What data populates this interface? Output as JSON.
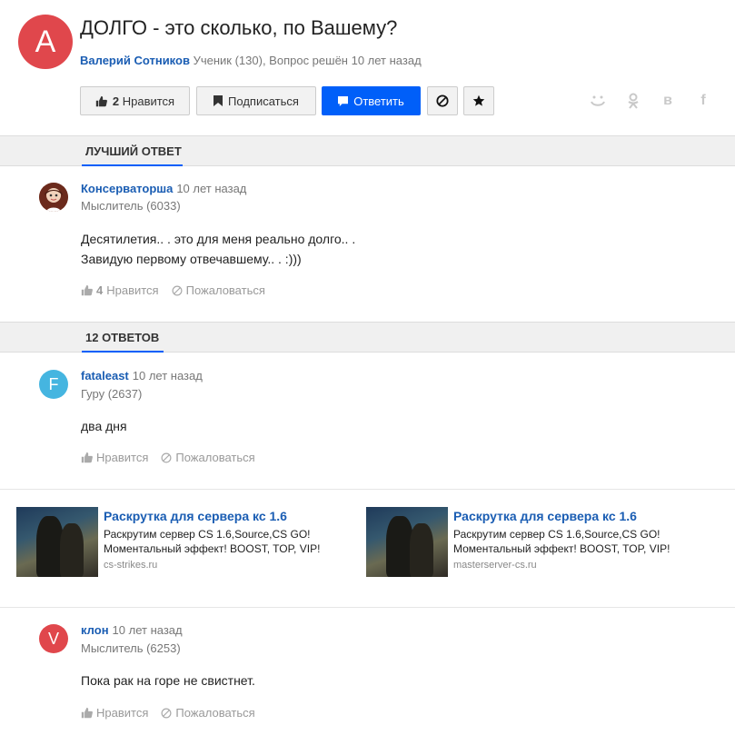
{
  "question": {
    "avatar_letter": "A",
    "title": "ДОЛГО - это сколько, по Вашему?",
    "author": "Валерий Сотников",
    "meta": "Ученик (130), Вопрос решён 10 лет назад",
    "like_count": "2",
    "like_label": "Нравится",
    "subscribe_label": "Подписаться",
    "reply_label": "Ответить",
    "share": [
      "smile",
      "ok",
      "в",
      "f"
    ]
  },
  "best": {
    "section_label": "ЛУЧШИЙ ОТВЕТ",
    "author": "Консерваторша",
    "time": "10 лет назад",
    "rank": "Мыслитель (6033)",
    "text_lines": [
      "Десятилетия.. . это для меня реально долго.. .",
      "Завидую первому отвечавшему.. . :)))"
    ],
    "like_count": "4",
    "like_label": "Нравится",
    "report_label": "Пожаловаться"
  },
  "answers_section_label": "12 ОТВЕТОВ",
  "answers": [
    {
      "avatar_letter": "F",
      "avatar_color": "#45b5e0",
      "author": "fataleast",
      "time": "10 лет назад",
      "rank": "Гуру (2637)",
      "text": "два дня",
      "like_label": "Нравится",
      "report_label": "Пожаловаться"
    },
    {
      "avatar_letter": "V",
      "avatar_color": "#e0474c",
      "author": "клон",
      "time": "10 лет назад",
      "rank": "Мыслитель (6253)",
      "text": "Пока рак на горе не свистнет.",
      "like_label": "Нравится",
      "report_label": "Пожаловаться"
    }
  ],
  "ads": [
    {
      "title": "Раскрутка для сервера кс 1.6",
      "desc1": "Раскрутим сервер CS 1.6,Source,CS GO!",
      "desc2": "Моментальный эффект! BOOST, TOP, VIP!",
      "domain": "cs-strikes.ru"
    },
    {
      "title": "Раскрутка для сервера кс 1.6",
      "desc1": "Раскрутим сервер CS 1.6,Source,CS GO!",
      "desc2": "Моментальный эффект! BOOST, TOP, VIP!",
      "domain": "masterserver-cs.ru"
    }
  ],
  "colors": {
    "primary": "#005ff9",
    "link": "#1a5db3",
    "avatar_red": "#e0474c"
  }
}
